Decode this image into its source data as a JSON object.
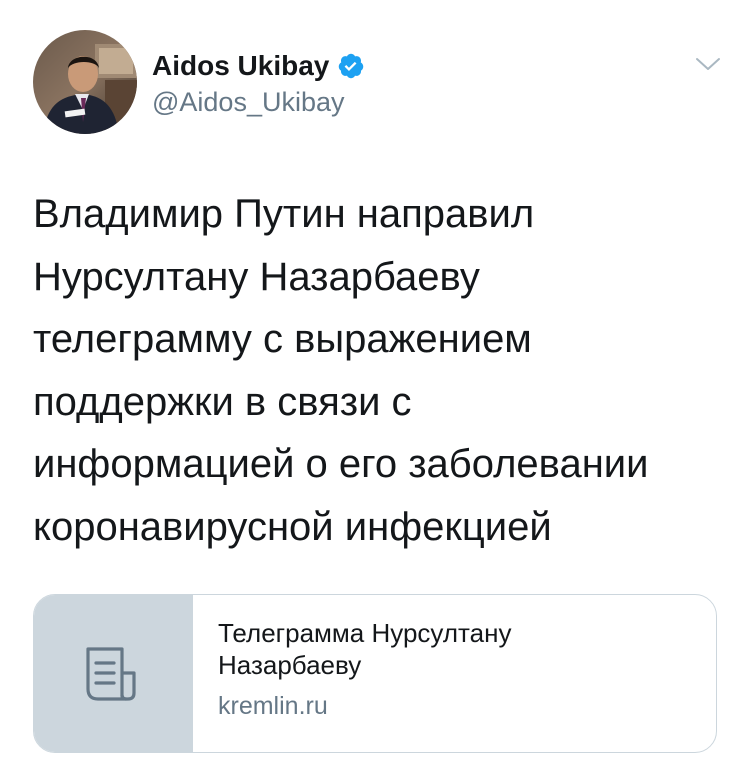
{
  "tweet": {
    "author": {
      "display_name": "Aidos Ukibay",
      "handle": "@Aidos_Ukibay",
      "verified": true
    },
    "text_lines": [
      "Владимир Путин направил",
      "Нурсултану Назарбаеву",
      "телеграмму с выражением",
      "поддержки в связи с",
      "информацией о его заболевании",
      "коронавирусной инфекцией"
    ],
    "link_card": {
      "title_lines": [
        "Телеграмма Нурсултану",
        "Назарбаеву"
      ],
      "domain": "kremlin.ru",
      "thumbnail_icon": "document-icon"
    },
    "menu_icon": "chevron-down-icon"
  },
  "colors": {
    "text_primary": "#14171a",
    "text_secondary": "#657786",
    "verified_blue": "#1da1f2",
    "card_border": "#ccd6dd",
    "card_thumb_bg": "#ccd6dd"
  }
}
